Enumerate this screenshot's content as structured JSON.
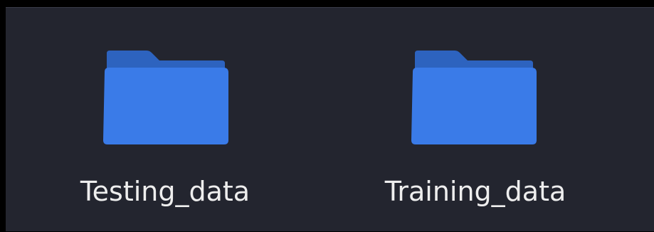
{
  "file_view": {
    "items": [
      {
        "name": "Testing_data",
        "icon": "folder-icon",
        "color": "#3a7be8"
      },
      {
        "name": "Training_data",
        "icon": "folder-icon",
        "color": "#3a7be8"
      }
    ]
  },
  "colors": {
    "background": "#23252f",
    "folder_front": "#3a7be8",
    "folder_back": "#2d63bf",
    "label_text": "#eeeeee"
  }
}
